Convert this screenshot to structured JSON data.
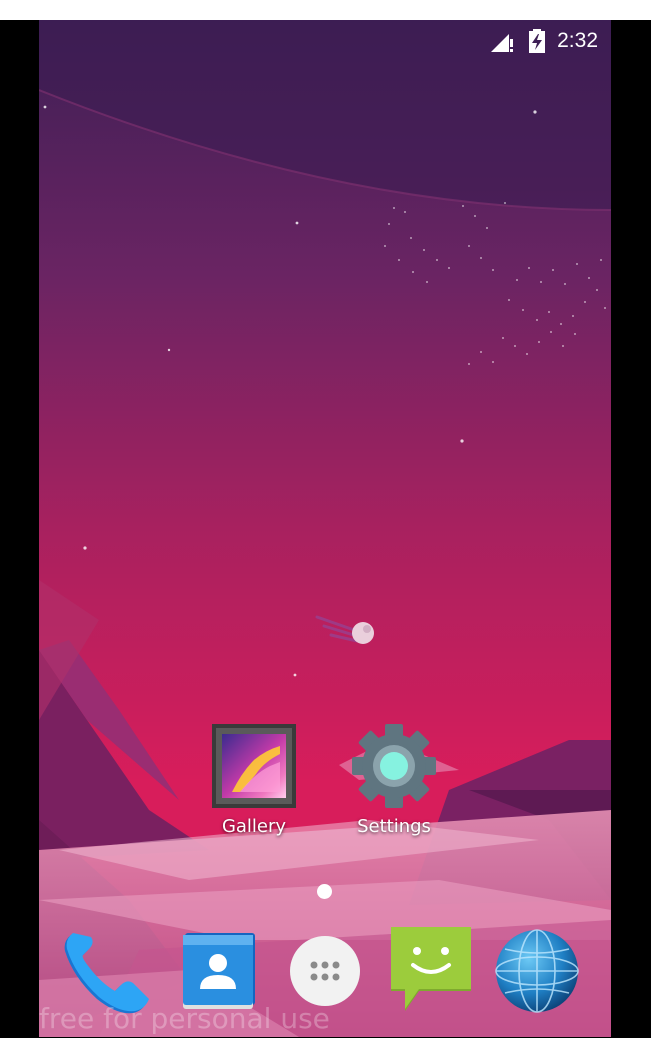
{
  "status_bar": {
    "time": "2:32",
    "icons": [
      "signal-no-service-icon",
      "battery-charging-icon"
    ]
  },
  "home_screen": {
    "shortcuts": [
      {
        "label": "Gallery",
        "icon": "gallery-icon"
      },
      {
        "label": "Settings",
        "icon": "settings-gear-icon"
      }
    ],
    "page_count": 1,
    "current_page": 1
  },
  "dock": {
    "items": [
      {
        "icon": "phone-icon"
      },
      {
        "icon": "contacts-icon"
      },
      {
        "icon": "app-drawer-icon"
      },
      {
        "icon": "messaging-icon"
      },
      {
        "icon": "browser-globe-icon"
      }
    ]
  },
  "wallpaper": {
    "watermark": "free for personal use",
    "colors": {
      "sky_top": "#3f1f55",
      "sky_bottom": "#d81e5b",
      "ground": "#e38bb0"
    }
  },
  "colors": {
    "phone_blue": "#2196f3",
    "contacts_blue": "#2a8fe0",
    "messaging_green": "#9ccc3c",
    "settings_teal": "#86f2e0"
  }
}
